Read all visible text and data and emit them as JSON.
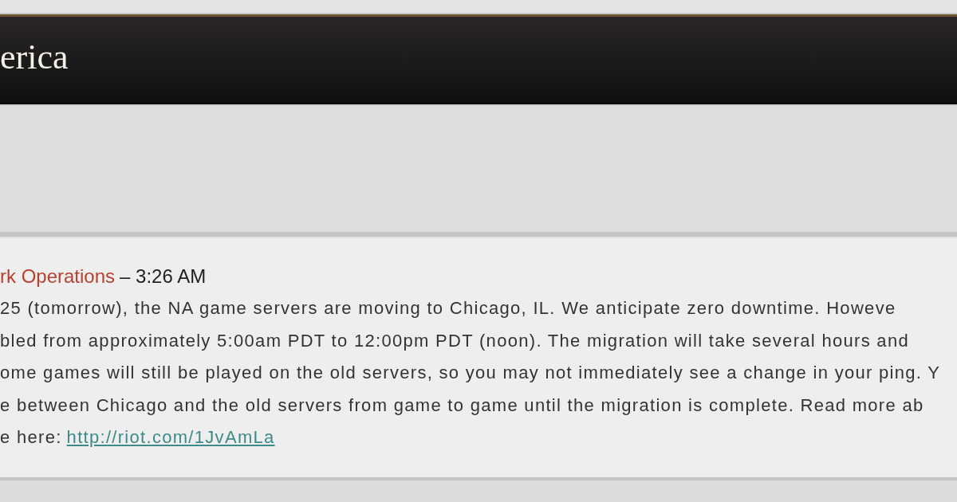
{
  "banner": {
    "title": "erica"
  },
  "post": {
    "author": "rk Operations",
    "time": "– 3:26 AM",
    "lines": [
      "25 (tomorrow), the NA game servers are moving to Chicago, IL. We anticipate zero downtime. Howeve",
      "bled from approximately 5:00am PDT to 12:00pm PDT (noon). The migration will take several hours and",
      "ome games will still be played on the old servers, so you may not immediately see a change in your ping. Y",
      "e between Chicago and the old servers from game to game until the migration is complete. Read more ab"
    ],
    "last_line": "e here:",
    "link": "http://riot.com/1JvAmLa"
  }
}
